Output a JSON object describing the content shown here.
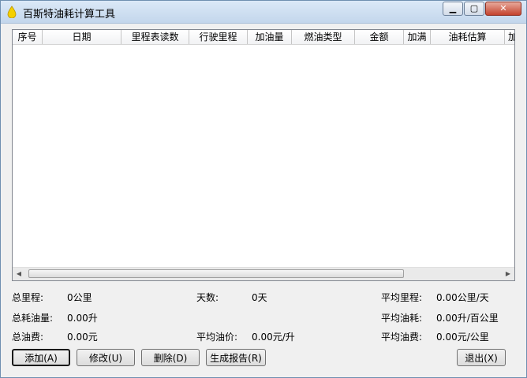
{
  "window": {
    "title": "百斯特油耗计算工具"
  },
  "icons": {
    "app": "fuel-drop-icon",
    "minimize": "minimize-icon",
    "maximize": "maximize-icon",
    "close": "close-icon"
  },
  "titlebar": {
    "min_glyph": "▁",
    "max_glyph": "▢",
    "close_glyph": "✕"
  },
  "table": {
    "columns": [
      "序号",
      "日期",
      "里程表读数",
      "行驶里程",
      "加油量",
      "燃油类型",
      "金额",
      "加满",
      "油耗估算",
      "加"
    ],
    "rows": []
  },
  "stats": {
    "total_mileage": {
      "label": "总里程:",
      "value": "0公里"
    },
    "days": {
      "label": "天数:",
      "value": "0天"
    },
    "avg_daily": {
      "label": "平均里程:",
      "value": "0.00公里/天"
    },
    "total_fuel": {
      "label": "总耗油量:",
      "value": "0.00升"
    },
    "avg_consumption": {
      "label": "平均油耗:",
      "value": "0.00升/百公里"
    },
    "total_cost": {
      "label": "总油费:",
      "value": "0.00元"
    },
    "avg_price": {
      "label": "平均油价:",
      "value": "0.00元/升"
    },
    "avg_cost": {
      "label": "平均油费:",
      "value": "0.00元/公里"
    }
  },
  "buttons": {
    "add": "添加(A)",
    "edit": "修改(U)",
    "delete": "删除(D)",
    "report": "生成报告(R)",
    "exit": "退出(X)"
  },
  "scroll": {
    "left_glyph": "◀",
    "right_glyph": "▶"
  }
}
